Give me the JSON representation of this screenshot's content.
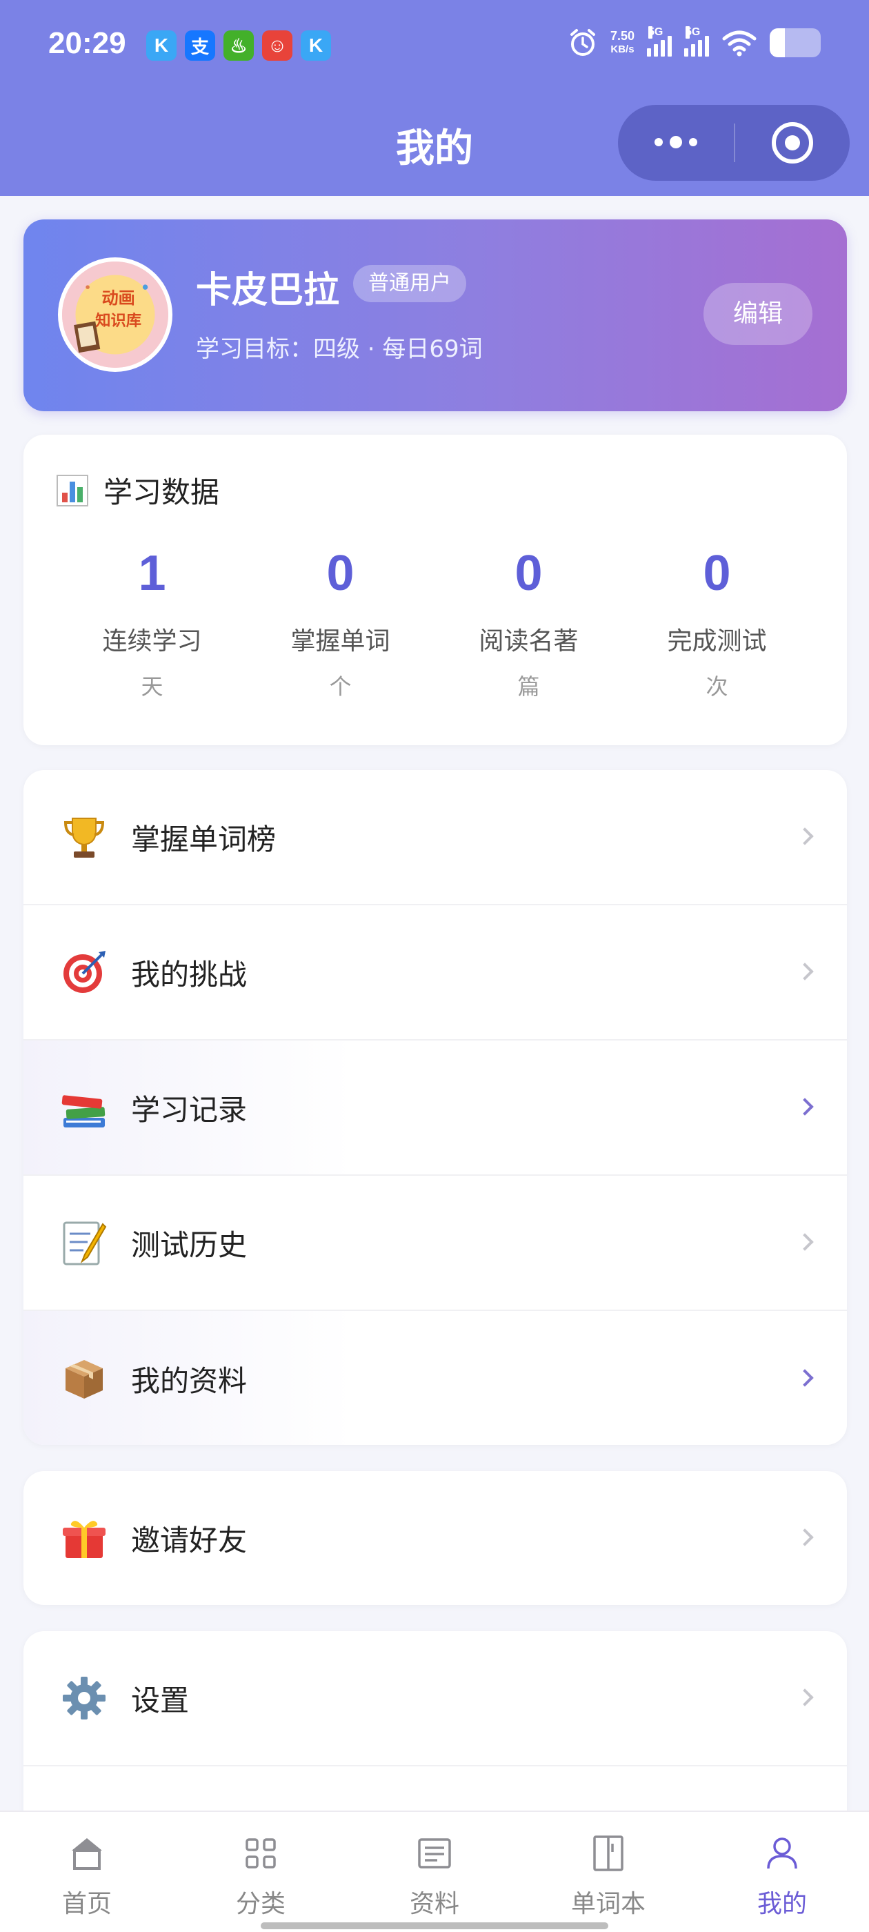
{
  "status_bar": {
    "time": "20:29",
    "app_icons": [
      {
        "glyph": "K",
        "color": "#3aa7f5",
        "name": "kuaishou-icon"
      },
      {
        "glyph": "支",
        "color": "#1677ff",
        "name": "alipay-icon"
      },
      {
        "glyph": "♨",
        "color": "#43b02a",
        "name": "app-green-icon"
      },
      {
        "glyph": "☺",
        "color": "#e8433a",
        "name": "app-red-icon"
      },
      {
        "glyph": "K",
        "color": "#3aa7f5",
        "name": "kuaishou-icon-2"
      }
    ],
    "net_speed_value": "7.50",
    "net_speed_unit": "KB/s",
    "signal_1": "5G",
    "signal_2": "5G"
  },
  "nav": {
    "title": "我的"
  },
  "profile": {
    "avatar_text_1": "动画",
    "avatar_text_2": "知识库",
    "name": "卡皮巴拉",
    "badge": "普通用户",
    "goal": "学习目标：四级 · 每日69词",
    "edit_label": "编辑"
  },
  "stats": {
    "title": "学习数据",
    "items": [
      {
        "value": "1",
        "label": "连续学习",
        "unit": "天"
      },
      {
        "value": "0",
        "label": "掌握单词",
        "unit": "个"
      },
      {
        "value": "0",
        "label": "阅读名著",
        "unit": "篇"
      },
      {
        "value": "0",
        "label": "完成测试",
        "unit": "次"
      }
    ]
  },
  "menu": {
    "items": [
      {
        "label": "掌握单词榜",
        "icon": "trophy-icon"
      },
      {
        "label": "我的挑战",
        "icon": "target-icon"
      },
      {
        "label": "学习记录",
        "icon": "books-icon"
      },
      {
        "label": "测试历史",
        "icon": "memo-icon"
      },
      {
        "label": "我的资料",
        "icon": "package-icon"
      }
    ],
    "invite_label": "邀请好友",
    "settings_label": "设置"
  },
  "tabbar": {
    "items": [
      {
        "label": "首页",
        "icon": "home-icon"
      },
      {
        "label": "分类",
        "icon": "grid-icon"
      },
      {
        "label": "资料",
        "icon": "document-icon"
      },
      {
        "label": "单词本",
        "icon": "book-icon"
      },
      {
        "label": "我的",
        "icon": "user-icon",
        "active": true
      }
    ]
  },
  "colors": {
    "header": "#7b82e6",
    "accent": "#5e5fd8",
    "active_tab": "#6b5cd6"
  }
}
